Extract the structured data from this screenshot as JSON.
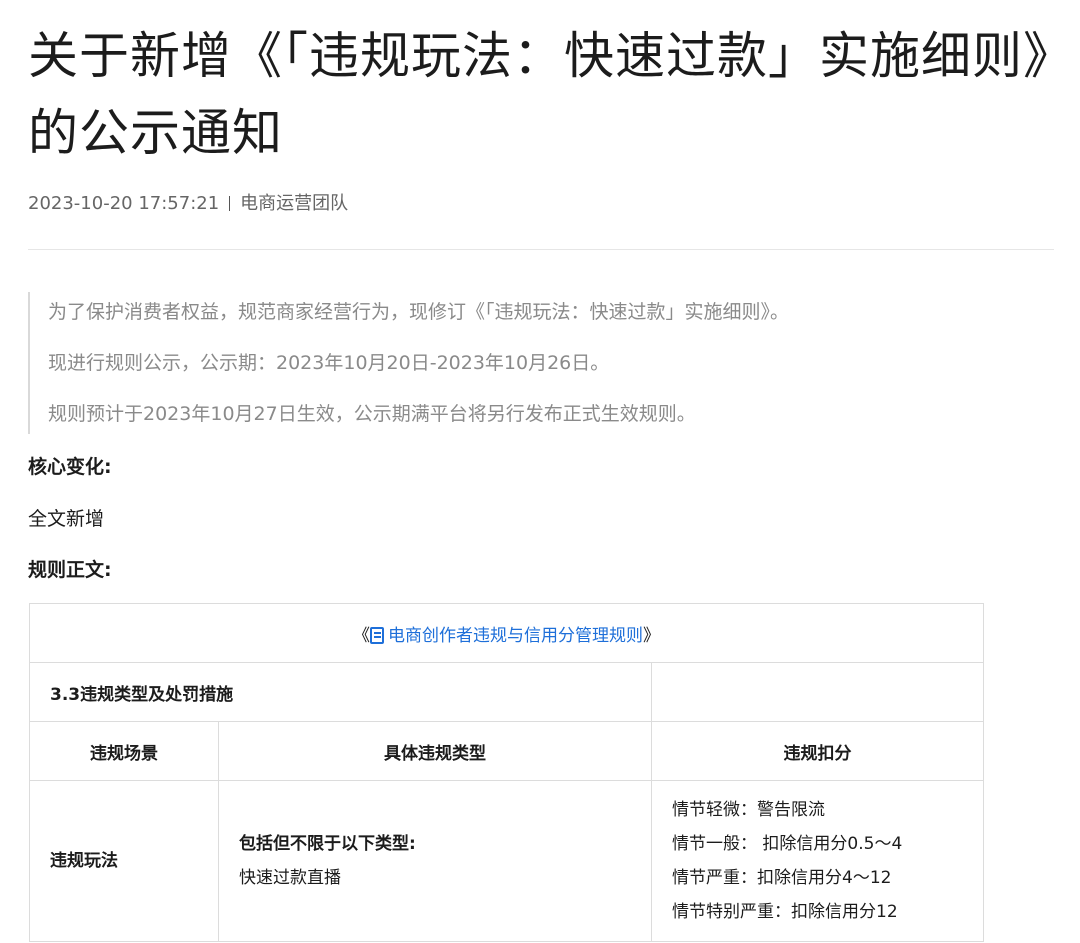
{
  "article": {
    "title": "关于新增《「违规玩法：快速过款」实施细则》的公示通知",
    "date": "2023-10-20 17:57:21",
    "author": "电商运营团队",
    "intro": [
      "为了保护消费者权益，规范商家经营行为，现修订《「违规玩法：快速过款」实施细则》。",
      "现进行规则公示，公示期：2023年10月20日-2023年10月26日。",
      "规则预计于2023年10月27日生效，公示期满平台将另行发布正式生效规则。"
    ],
    "core_change_label": "核心变化:",
    "core_change_value": "全文新增",
    "rule_body_label": "规则正文:"
  },
  "table": {
    "link_prefix": "《",
    "link_text": "电商创作者违规与信用分管理规则",
    "link_suffix": "》",
    "section": "3.3违规类型及处罚措施",
    "headers": [
      "违规场景",
      "具体违规类型",
      "违规扣分"
    ],
    "row": {
      "scene": "违规玩法",
      "type_title": "包括但不限于以下类型:",
      "type_item": "快速过款直播",
      "penalties": [
        "情节轻微：警告限流",
        "情节一般： 扣除信用分0.5～4",
        "情节严重：扣除信用分4～12",
        "情节特别严重：扣除信用分12"
      ]
    }
  },
  "icons": {
    "link_icon": "document-icon"
  },
  "colors": {
    "link": "#1e6fd9",
    "quote_text": "#8a8a8a"
  }
}
